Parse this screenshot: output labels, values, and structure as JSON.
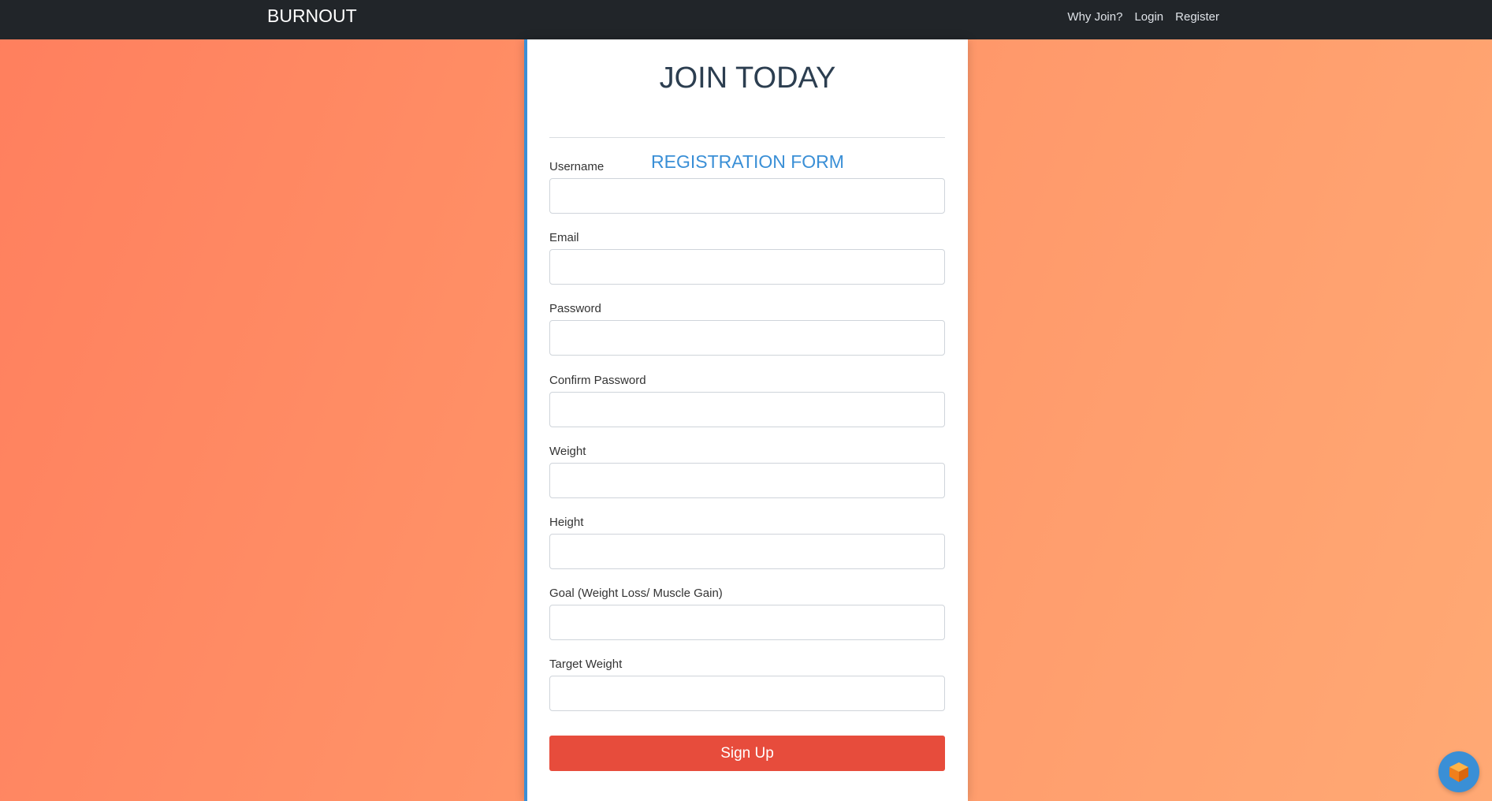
{
  "navbar": {
    "brand": "BURNOUT",
    "links": [
      {
        "label": "Why Join?"
      },
      {
        "label": "Login"
      },
      {
        "label": "Register"
      }
    ]
  },
  "form": {
    "title": "JOIN TODAY",
    "subtitle": "REGISTRATION FORM",
    "fields": [
      {
        "label": "Username",
        "value": ""
      },
      {
        "label": "Email",
        "value": ""
      },
      {
        "label": "Password",
        "value": ""
      },
      {
        "label": "Confirm Password",
        "value": ""
      },
      {
        "label": "Weight",
        "value": ""
      },
      {
        "label": "Height",
        "value": ""
      },
      {
        "label": "Goal (Weight Loss/ Muscle Gain)",
        "value": ""
      },
      {
        "label": "Target Weight",
        "value": ""
      }
    ],
    "submit_label": "Sign Up"
  },
  "colors": {
    "navbar": "#212529",
    "accent": "#3a8fd6",
    "submit": "#e74c3c",
    "title": "#2c3e50"
  },
  "widget": {
    "icon": "cube-icon"
  }
}
